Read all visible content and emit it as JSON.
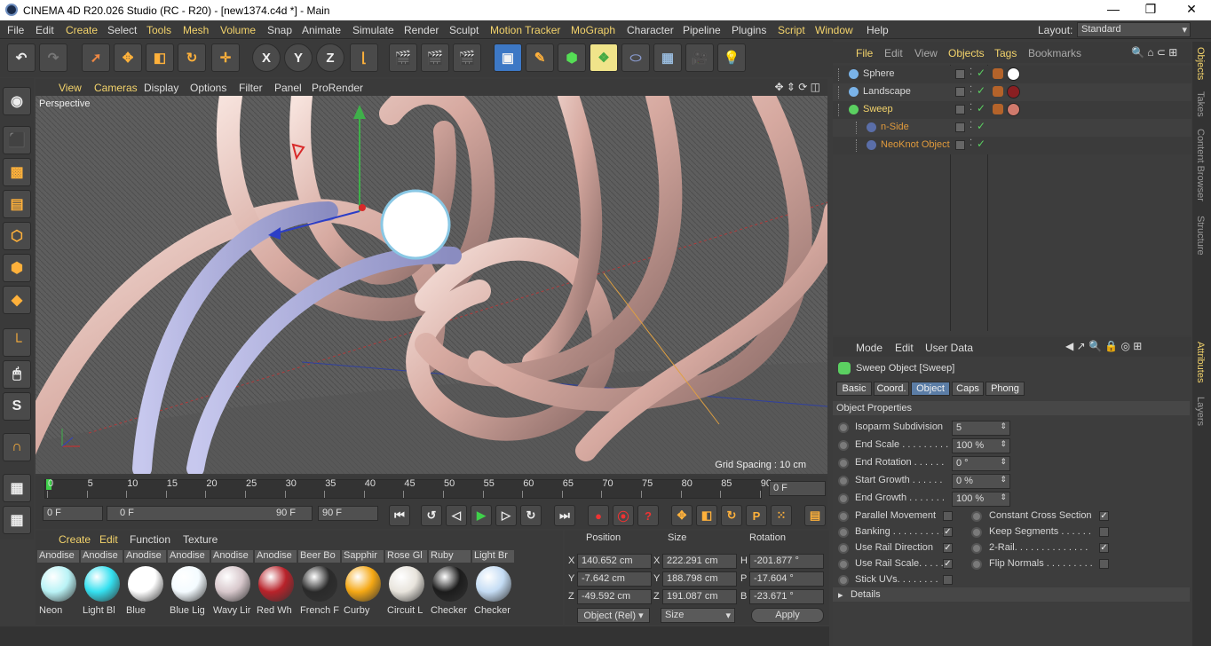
{
  "window": {
    "title": "CINEMA 4D R20.026 Studio (RC - R20) - [new1374.c4d *] - Main"
  },
  "menu": {
    "items": [
      "File",
      "Edit",
      "Create",
      "Select",
      "Tools",
      "Mesh",
      "Volume",
      "Snap",
      "Animate",
      "Simulate",
      "Render",
      "Sculpt",
      "Motion Tracker",
      "MoGraph",
      "Character",
      "Pipeline",
      "Plugins",
      "Script",
      "Window",
      "Help"
    ],
    "layout_label": "Layout:",
    "layout_value": "Standard"
  },
  "viewport": {
    "menu": [
      "View",
      "Cameras",
      "Display",
      "Options",
      "Filter",
      "Panel",
      "ProRender"
    ],
    "label": "Perspective",
    "grid_spacing": "Grid Spacing : 10 cm"
  },
  "timeline": {
    "ticks": [
      "0",
      "5",
      "10",
      "15",
      "20",
      "25",
      "30",
      "35",
      "40",
      "45",
      "50",
      "55",
      "60",
      "65",
      "70",
      "75",
      "80",
      "85",
      "90"
    ],
    "current_frame": "0 F",
    "start": "0 F",
    "range_start": "0 F",
    "range_end": "90 F",
    "end": "90 F"
  },
  "materials": {
    "menu": [
      "Create",
      "Edit",
      "Function",
      "Texture"
    ],
    "items": [
      {
        "top": "Anodise",
        "bottom": "Neon",
        "color": "#b9f3f6"
      },
      {
        "top": "Anodise",
        "bottom": "Light Bl",
        "color": "#34e0f0"
      },
      {
        "top": "Anodise",
        "bottom": "Blue",
        "color": "#ffffff"
      },
      {
        "top": "Anodise",
        "bottom": "Blue Lig",
        "color": "#f4fbff"
      },
      {
        "top": "Anodise",
        "bottom": "Wavy Lir",
        "color": "#d8c8cc"
      },
      {
        "top": "Anodise",
        "bottom": "Red Wh",
        "color": "#b8222a"
      },
      {
        "top": "Beer Bo",
        "bottom": "French F",
        "color": "#2a2a2a"
      },
      {
        "top": "Sapphir",
        "bottom": "Curby",
        "color": "#f5a814"
      },
      {
        "top": "Rose Gl",
        "bottom": "Circuit L",
        "color": "#e8e4dc"
      },
      {
        "top": "Ruby",
        "bottom": "Checker",
        "color": "#1c1c1c"
      },
      {
        "top": "Light Br",
        "bottom": "Checker",
        "color": "#c4dcf4"
      }
    ]
  },
  "coords": {
    "headers": {
      "position": "Position",
      "size": "Size",
      "rotation": "Rotation"
    },
    "rows": [
      {
        "axis": "X",
        "pos": "140.652 cm",
        "saxis": "X",
        "size": "222.291 cm",
        "raxis": "H",
        "rot": "-201.877 °"
      },
      {
        "axis": "Y",
        "pos": "-7.642 cm",
        "saxis": "Y",
        "size": "188.798 cm",
        "raxis": "P",
        "rot": "-17.604 °"
      },
      {
        "axis": "Z",
        "pos": "-49.592 cm",
        "saxis": "Z",
        "size": "191.087 cm",
        "raxis": "B",
        "rot": "-23.671 °"
      }
    ],
    "mode": "Object (Rel)",
    "size_mode": "Size",
    "apply": "Apply"
  },
  "objects": {
    "menu": [
      "File",
      "Edit",
      "View",
      "Objects",
      "Tags",
      "Bookmarks"
    ],
    "items": [
      {
        "name": "Sphere",
        "color": "#d8d8d8",
        "indent": 0
      },
      {
        "name": "Landscape",
        "color": "#d8d8d8",
        "indent": 0
      },
      {
        "name": "Sweep",
        "color": "#f3d36b",
        "indent": 0
      },
      {
        "name": "n-Side",
        "color": "#e09a3c",
        "indent": 1
      },
      {
        "name": "NeoKnot Object",
        "color": "#e09a3c",
        "indent": 1
      }
    ]
  },
  "sidetabs": [
    "Objects",
    "Takes",
    "Content Browser",
    "Structure",
    "Attributes",
    "Layers"
  ],
  "attributes": {
    "menu": [
      "Mode",
      "Edit",
      "User Data"
    ],
    "object_title": "Sweep Object [Sweep]",
    "tabs": [
      "Basic",
      "Coord.",
      "Object",
      "Caps",
      "Phong"
    ],
    "active_tab": "Object",
    "section": "Object Properties",
    "fields": [
      {
        "label": "Isoparm Subdivision",
        "value": "5"
      },
      {
        "label": "End Scale . . . . . . . . . .",
        "value": "100 %"
      },
      {
        "label": "End Rotation . . . . . .",
        "value": "0 °"
      },
      {
        "label": "Start Growth . . . . . .",
        "value": "0 %"
      },
      {
        "label": "End Growth . . . . . . .",
        "value": "100 %"
      }
    ],
    "checks_left": [
      {
        "label": "Parallel Movement",
        "checked": false
      },
      {
        "label": "Banking . . . . . . . . . .",
        "checked": true
      },
      {
        "label": "Use Rail Direction",
        "checked": true
      },
      {
        "label": "Use Rail Scale. . . . .",
        "checked": true
      },
      {
        "label": "Stick UVs. . . . . . . .",
        "checked": false
      }
    ],
    "checks_right": [
      {
        "label": "Constant Cross Section",
        "checked": true
      },
      {
        "label": "Keep Segments . . . . . .",
        "checked": false
      },
      {
        "label": "2-Rail. . . . . . . . . . . . . .",
        "checked": true
      },
      {
        "label": "Flip Normals . . . . . . . . .",
        "checked": false
      }
    ],
    "details": "Details"
  }
}
